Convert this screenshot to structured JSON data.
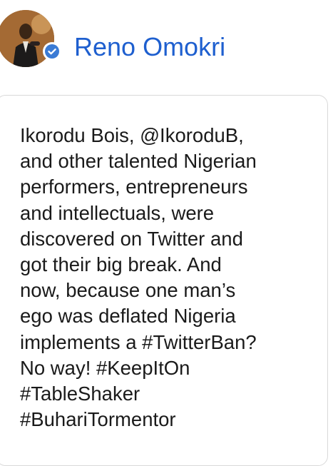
{
  "author": {
    "name": "Reno Omokri",
    "avatar_icon": "profile-photo",
    "verified_icon": "verified-check-icon"
  },
  "post": {
    "lines": [
      "Ikorodu Bois, @IkoroduB,",
      "and other talented Nigerian",
      "performers, entrepreneurs",
      "and intellectuals, were",
      "discovered on Twitter and",
      "got their big break. And",
      "now, because one man’s",
      "ego was deflated Nigeria",
      "implements a #TwitterBan?",
      "No way! #KeepItOn",
      "#TableShaker",
      "#BuhariTormentor"
    ]
  },
  "colors": {
    "name": "#1e5fcf",
    "badge": "#3a7bd5",
    "text": "#1a1a1a",
    "border": "#d9d9d9"
  }
}
